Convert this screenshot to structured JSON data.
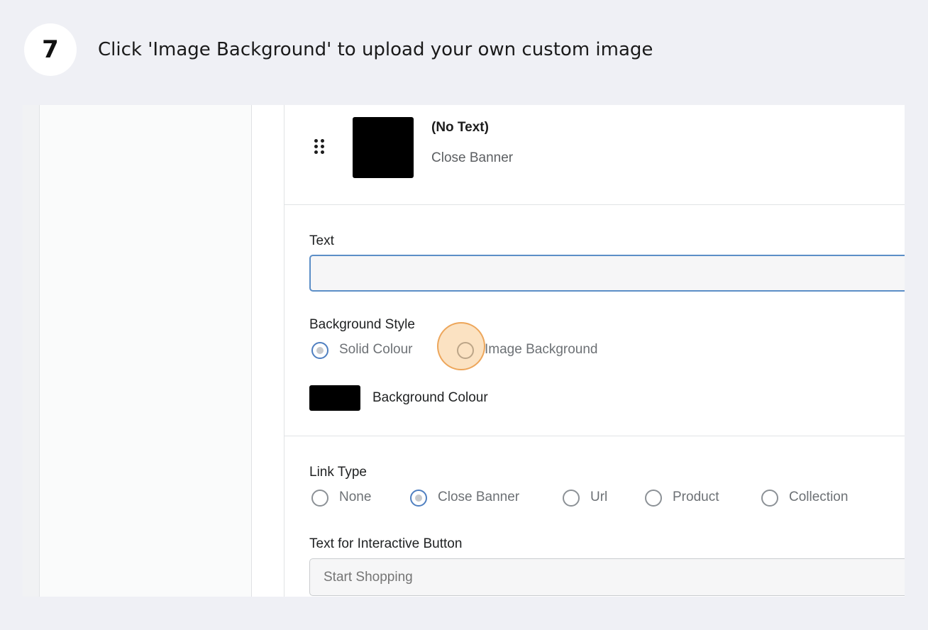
{
  "guide": {
    "step_number": "7",
    "instruction": "Click 'Image Background' to upload your own custom image"
  },
  "banner_item": {
    "title": "(No Text)",
    "subtitle": "Close Banner",
    "thumbnail_color": "#000000",
    "handle_icon": "drag-handle-icon"
  },
  "text_field": {
    "label": "Text",
    "value": ""
  },
  "background_style": {
    "label": "Background Style",
    "options": [
      {
        "label": "Solid Colour",
        "checked": true
      },
      {
        "label": "Image Background",
        "checked": false
      }
    ],
    "colour_label": "Background Colour",
    "colour_value": "#000000"
  },
  "link_type": {
    "label": "Link Type",
    "options": [
      {
        "label": "None",
        "checked": false
      },
      {
        "label": "Close Banner",
        "checked": true
      },
      {
        "label": "Url",
        "checked": false
      },
      {
        "label": "Product",
        "checked": false
      },
      {
        "label": "Collection",
        "checked": false
      }
    ]
  },
  "interactive_button": {
    "label": "Text for Interactive Button",
    "placeholder": "Start Shopping"
  },
  "colors": {
    "accent": "#4f7fc0",
    "highlight": "#f7be78",
    "page_background": "#eff0f5"
  }
}
